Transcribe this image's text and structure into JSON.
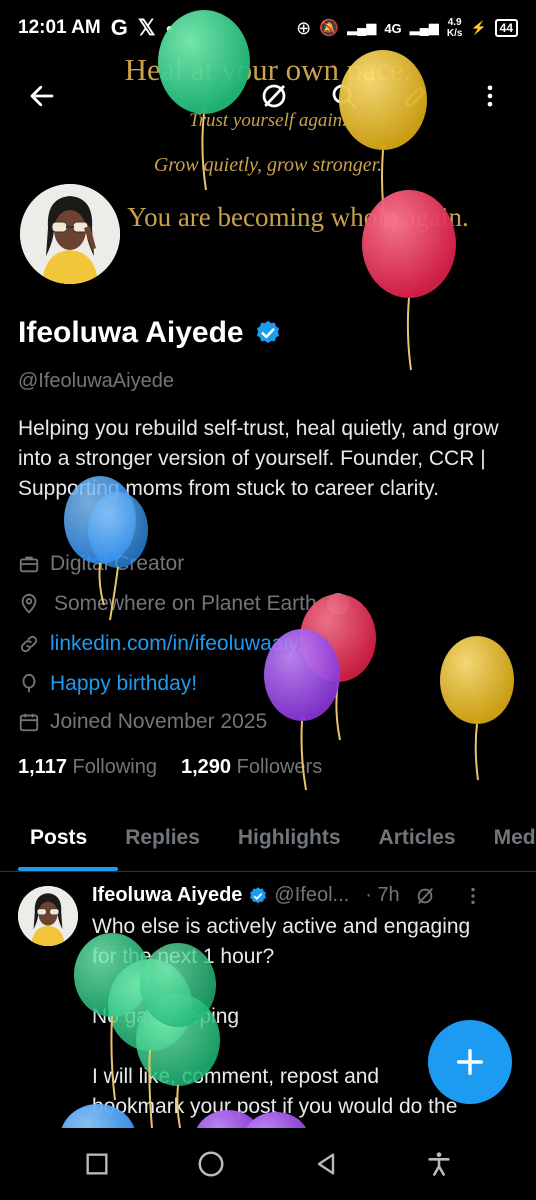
{
  "status_bar": {
    "time": "12:01 AM",
    "network": "4G",
    "speed_value": "4.9",
    "speed_unit": "K/s",
    "battery": "44"
  },
  "banner": {
    "line1": "Heal at your own pace.",
    "line2": "Trust yourself again.",
    "line3": "Grow quietly, grow stronger.",
    "line4": "You are becoming whole again."
  },
  "profile": {
    "name": "Ifeoluwa Aiyede",
    "handle": "@IfeoluwaAiyede",
    "bio": "Helping you rebuild self-trust, heal quietly, and grow into a stronger version of yourself. Founder, CCR | Supporting moms from stuck to career clarity.",
    "category": "Digital Creator",
    "location": "Somewhere on Planet Earth",
    "website": "linkedin.com/in/ifeoluwaaiy...",
    "birthday": "Happy birthday!",
    "joined": "Joined November 2025",
    "following_count": "1,117",
    "following_label": "Following",
    "followers_count": "1,290",
    "followers_label": "Followers"
  },
  "tabs": [
    "Posts",
    "Replies",
    "Highlights",
    "Articles",
    "Media"
  ],
  "post": {
    "author": "Ifeoluwa Aiyede",
    "handle": "@Ifeol...",
    "time": "· 7h",
    "line1": "Who else is actively active and engaging",
    "line2": "for the next 1 hour?",
    "line3": "No gatekeeping",
    "line4": "I will like, comment, repost and",
    "line5": "bookmark your post if you would do the"
  },
  "colors": {
    "accent": "#1d9bf0",
    "muted": "#71767b",
    "banner_gold": "#c9a24a"
  }
}
